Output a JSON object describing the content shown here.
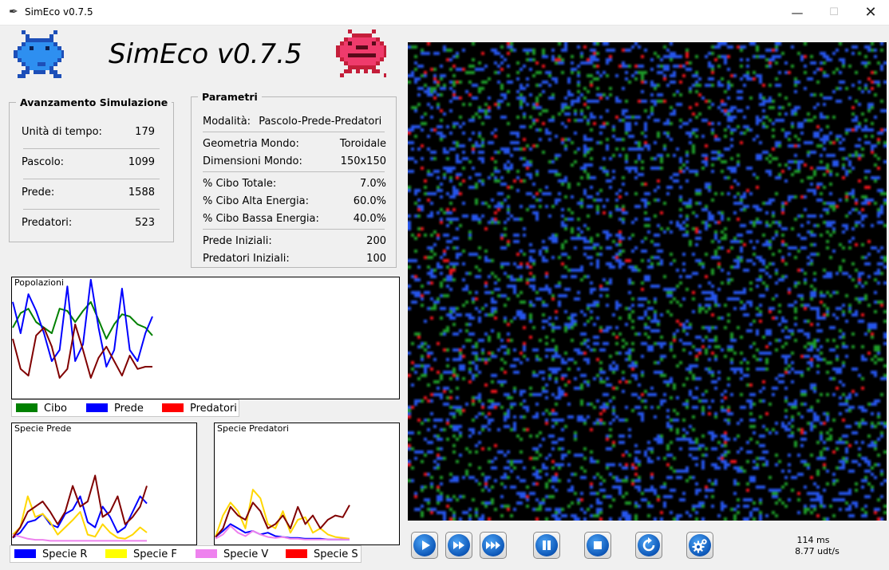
{
  "window": {
    "title": "SimEco v0.7.5",
    "minimize": "—",
    "maximize": "☐",
    "close": "✕"
  },
  "app_title": "SimEco v0.7.5",
  "progress": {
    "legend": "Avanzamento Simulazione",
    "rows": [
      {
        "label": "Unità di tempo:",
        "value": "179"
      },
      {
        "label": "Pascolo:",
        "value": "1099"
      },
      {
        "label": "Prede:",
        "value": "1588"
      },
      {
        "label": "Predatori:",
        "value": "523"
      }
    ]
  },
  "params": {
    "legend": "Parametri",
    "mode_label": "Modalità:",
    "mode_value": "Pascolo-Prede-Predatori",
    "rows": [
      {
        "label": "Geometria Mondo:",
        "value": "Toroidale"
      },
      {
        "label": "Dimensioni Mondo:",
        "value": "150x150"
      },
      {
        "label": "% Cibo Totale:",
        "value": "7.0%"
      },
      {
        "label": "% Cibo Alta Energia:",
        "value": "60.0%"
      },
      {
        "label": "% Cibo Bassa Energia:",
        "value": "40.0%"
      },
      {
        "label": "Prede Iniziali:",
        "value": "200"
      },
      {
        "label": "Predatori Iniziali:",
        "value": "100"
      }
    ]
  },
  "plots": {
    "popolazioni": {
      "title": "Popolazioni"
    },
    "specie_prede": {
      "title": "Specie Prede"
    },
    "specie_predatori": {
      "title": "Specie Predatori"
    }
  },
  "legend_pop": [
    {
      "label": "Cibo",
      "color": "#008000"
    },
    {
      "label": "Prede",
      "color": "#0000ff"
    },
    {
      "label": "Predatori",
      "color": "#ff0000"
    }
  ],
  "legend_species": [
    {
      "label": "Specie R",
      "color": "#0000ff"
    },
    {
      "label": "Specie F",
      "color": "#ffff00"
    },
    {
      "label": "Specie V",
      "color": "#ee82ee"
    },
    {
      "label": "Specie S",
      "color": "#ff0000"
    }
  ],
  "controls": [
    {
      "name": "play-icon"
    },
    {
      "name": "fast-forward-icon"
    },
    {
      "name": "skip-forward-icon"
    },
    {
      "name": "pause-icon"
    },
    {
      "name": "stop-icon"
    },
    {
      "name": "reset-icon"
    },
    {
      "name": "settings-gear-icon"
    }
  ],
  "status": {
    "ms": "114 ms",
    "rate": "8.77 udt/s"
  },
  "chart_data": [
    {
      "type": "line",
      "title": "Popolazioni",
      "x": [
        0,
        10,
        20,
        30,
        40,
        50,
        60,
        70,
        80,
        90,
        100,
        110,
        120,
        130,
        140,
        150,
        160,
        170,
        179
      ],
      "series": [
        {
          "name": "Cibo",
          "color": "#008000",
          "values": [
            0.55,
            0.68,
            0.72,
            0.6,
            0.55,
            0.5,
            0.72,
            0.7,
            0.6,
            0.7,
            0.78,
            0.62,
            0.45,
            0.58,
            0.67,
            0.65,
            0.58,
            0.55,
            0.48
          ]
        },
        {
          "name": "Prede",
          "color": "#0000ff",
          "values": [
            0.78,
            0.5,
            0.85,
            0.7,
            0.5,
            0.25,
            0.35,
            0.92,
            0.25,
            0.4,
            0.98,
            0.55,
            0.2,
            0.35,
            0.9,
            0.35,
            0.25,
            0.5,
            0.65
          ]
        },
        {
          "name": "Predatori",
          "color": "#800000",
          "values": [
            0.45,
            0.18,
            0.12,
            0.48,
            0.55,
            0.38,
            0.1,
            0.18,
            0.58,
            0.35,
            0.1,
            0.28,
            0.38,
            0.25,
            0.12,
            0.3,
            0.18,
            0.2,
            0.2
          ]
        }
      ],
      "ylim": [
        0,
        1
      ]
    },
    {
      "type": "line",
      "title": "Specie Prede",
      "x": [
        0,
        10,
        20,
        30,
        40,
        50,
        60,
        70,
        80,
        90,
        100,
        110,
        120,
        130,
        140,
        150,
        160,
        170,
        179
      ],
      "series": [
        {
          "name": "Specie R",
          "color": "#0000ff",
          "values": [
            0.05,
            0.1,
            0.2,
            0.22,
            0.28,
            0.18,
            0.15,
            0.28,
            0.32,
            0.45,
            0.2,
            0.15,
            0.35,
            0.25,
            0.1,
            0.15,
            0.3,
            0.45,
            0.38
          ]
        },
        {
          "name": "Specie F",
          "color": "#ffd700",
          "values": [
            0.08,
            0.15,
            0.45,
            0.25,
            0.28,
            0.2,
            0.08,
            0.15,
            0.22,
            0.3,
            0.08,
            0.06,
            0.18,
            0.1,
            0.05,
            0.04,
            0.08,
            0.15,
            0.1
          ]
        },
        {
          "name": "Specie V",
          "color": "#ee82ee",
          "values": [
            0.08,
            0.06,
            0.04,
            0.03,
            0.03,
            0.02,
            0.02,
            0.02,
            0.02,
            0.02,
            0.02,
            0.02,
            0.02,
            0.02,
            0.02,
            0.02,
            0.02,
            0.02,
            0.02
          ]
        },
        {
          "name": "Specie S",
          "color": "#800000",
          "values": [
            0.05,
            0.15,
            0.3,
            0.35,
            0.4,
            0.3,
            0.18,
            0.3,
            0.55,
            0.35,
            0.4,
            0.65,
            0.25,
            0.3,
            0.45,
            0.18,
            0.25,
            0.35,
            0.55
          ]
        }
      ],
      "ylim": [
        0,
        1
      ]
    },
    {
      "type": "line",
      "title": "Specie Predatori",
      "x": [
        0,
        10,
        20,
        30,
        40,
        50,
        60,
        70,
        80,
        90,
        100,
        110,
        120,
        130,
        140,
        150,
        160,
        170,
        179
      ],
      "series": [
        {
          "name": "Specie R",
          "color": "#0000ff",
          "values": [
            0.05,
            0.12,
            0.2,
            0.15,
            0.1,
            0.12,
            0.08,
            0.1,
            0.06,
            0.05,
            0.04,
            0.04,
            0.03,
            0.03,
            0.03,
            0.02,
            0.02,
            0.02,
            0.02
          ]
        },
        {
          "name": "Specie F",
          "color": "#ffd700",
          "values": [
            0.05,
            0.3,
            0.45,
            0.35,
            0.15,
            0.6,
            0.5,
            0.2,
            0.15,
            0.35,
            0.1,
            0.25,
            0.28,
            0.1,
            0.15,
            0.08,
            0.05,
            0.04,
            0.03
          ]
        },
        {
          "name": "Specie V",
          "color": "#ee82ee",
          "values": [
            0.03,
            0.08,
            0.18,
            0.1,
            0.06,
            0.12,
            0.08,
            0.05,
            0.04,
            0.05,
            0.03,
            0.03,
            0.02,
            0.02,
            0.02,
            0.02,
            0.02,
            0.02,
            0.02
          ]
        },
        {
          "name": "Specie S",
          "color": "#800000",
          "values": [
            0.05,
            0.15,
            0.4,
            0.3,
            0.25,
            0.45,
            0.35,
            0.15,
            0.2,
            0.3,
            0.15,
            0.4,
            0.2,
            0.3,
            0.15,
            0.25,
            0.3,
            0.28,
            0.42
          ]
        }
      ],
      "ylim": [
        0,
        1
      ]
    }
  ]
}
